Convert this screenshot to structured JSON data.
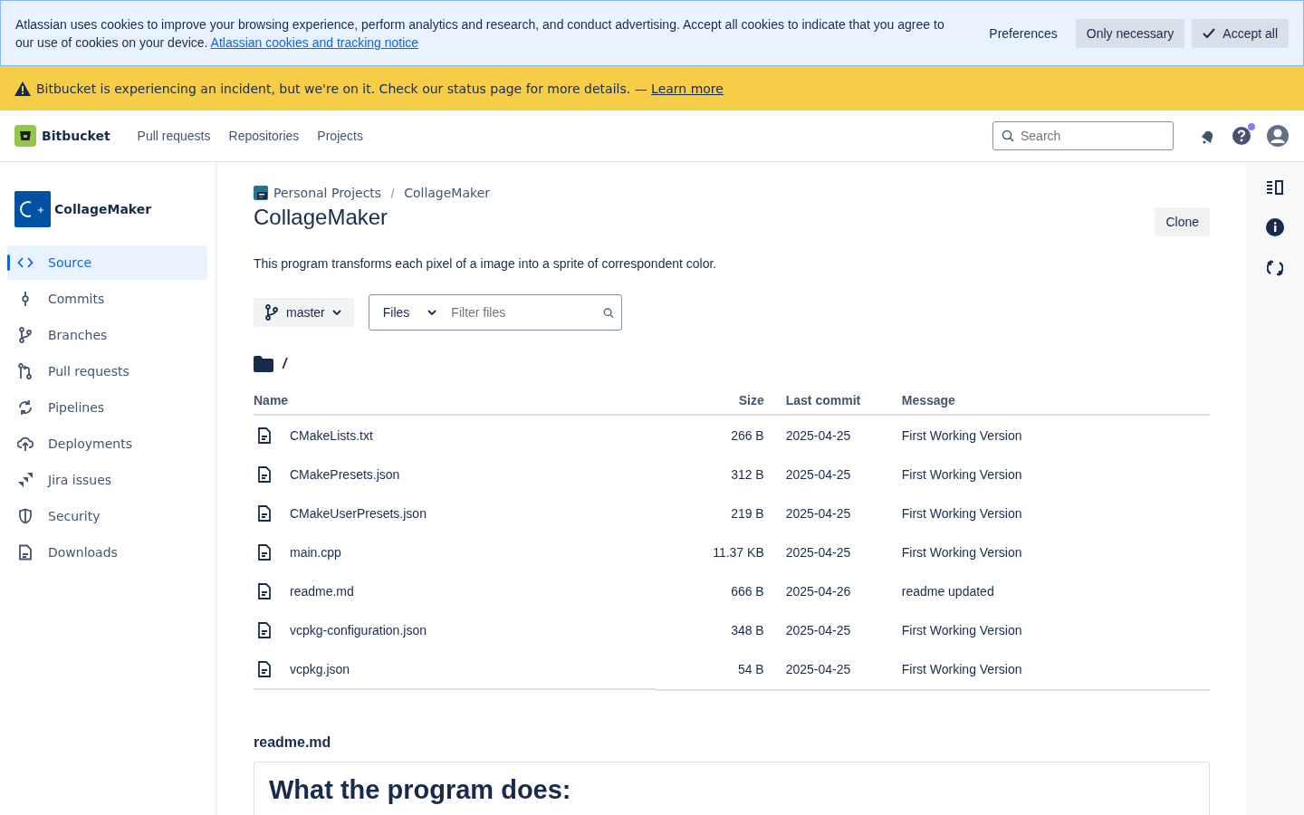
{
  "cookie_banner": {
    "text": "Atlassian uses cookies to improve your browsing experience, perform analytics and research, and conduct advertising. Accept all cookies to indicate that you agree to our use of cookies on your device.",
    "link": "Atlassian cookies and tracking notice",
    "buttons": [
      {
        "label": "Preferences",
        "kind": "subtle"
      },
      {
        "label": "Only necessary",
        "kind": "default"
      },
      {
        "label": "Accept all",
        "kind": "check"
      }
    ]
  },
  "incident_banner": {
    "text": "Bitbucket is experiencing an incident, but we're on it. Check our status page for more details. —",
    "link": "Learn more"
  },
  "top_nav": {
    "product": "Bitbucket",
    "items": [
      "Pull requests",
      "Repositories",
      "Projects"
    ],
    "search": {
      "placeholder": "Search"
    },
    "help_has_notification": true
  },
  "sidebar": {
    "repo_name": "CollageMaker",
    "items": [
      {
        "label": "Source",
        "selected": true
      },
      {
        "label": "Commits",
        "selected": false
      },
      {
        "label": "Branches",
        "selected": false
      },
      {
        "label": "Pull requests",
        "selected": false
      },
      {
        "label": "Pipelines",
        "selected": false
      },
      {
        "label": "Deployments",
        "selected": false
      },
      {
        "label": "Jira issues",
        "selected": false
      },
      {
        "label": "Security",
        "selected": false
      },
      {
        "label": "Downloads",
        "selected": false
      }
    ]
  },
  "breadcrumbs": [
    "Personal Projects",
    "CollageMaker"
  ],
  "repo_title": "CollageMaker",
  "clone_button": "Clone",
  "description": "This program transforms each pixel of a image into a sprite of correspondent color.",
  "branch_button": "master",
  "file_filter": {
    "type": "Files",
    "placeholder": "Filter files"
  },
  "path": "/",
  "table": {
    "columns": [
      "Name",
      "Size",
      "Last commit",
      "Message"
    ],
    "rows": [
      {
        "name": "CMakeLists.txt",
        "size": "266 B",
        "last_commit": "2025-04-25",
        "message": "First Working Version"
      },
      {
        "name": "CMakePresets.json",
        "size": "312 B",
        "last_commit": "2025-04-25",
        "message": "First Working Version"
      },
      {
        "name": "CMakeUserPresets.json",
        "size": "219 B",
        "last_commit": "2025-04-25",
        "message": "First Working Version"
      },
      {
        "name": "main.cpp",
        "size": "11.37 KB",
        "last_commit": "2025-04-25",
        "message": "First Working Version"
      },
      {
        "name": "readme.md",
        "size": "666 B",
        "last_commit": "2025-04-26",
        "message": "readme updated"
      },
      {
        "name": "vcpkg-configuration.json",
        "size": "348 B",
        "last_commit": "2025-04-25",
        "message": "First Working Version"
      },
      {
        "name": "vcpkg.json",
        "size": "54 B",
        "last_commit": "2025-04-25",
        "message": "First Working Version"
      }
    ]
  },
  "readme": {
    "filename": "readme.md",
    "heading": "What the program does:"
  }
}
